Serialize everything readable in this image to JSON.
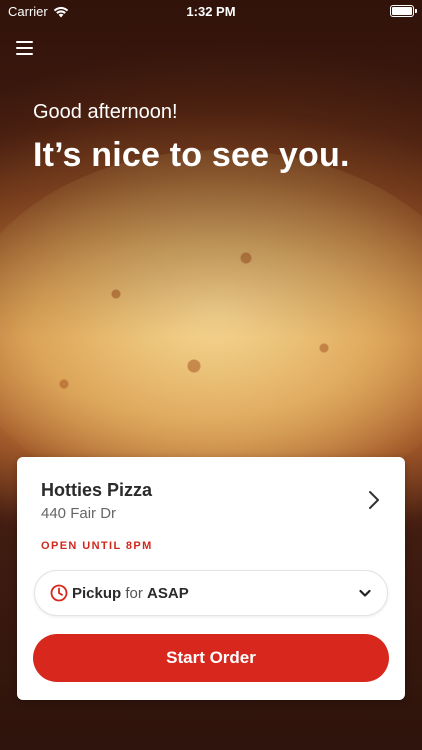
{
  "status_bar": {
    "carrier": "Carrier",
    "time": "1:32 PM"
  },
  "hero": {
    "greeting": "Good afternoon!",
    "headline": "It’s nice to see you."
  },
  "store": {
    "name": "Hotties Pizza",
    "address": "440 Fair Dr",
    "hours_status": "OPEN UNTIL 8PM"
  },
  "order": {
    "type": "Pickup",
    "connector": "for",
    "time": "ASAP"
  },
  "actions": {
    "start_order": "Start Order"
  },
  "colors": {
    "accent": "#d8281d",
    "status_text": "#d0281c"
  },
  "icons": {
    "menu": "hamburger-menu-icon",
    "wifi": "wifi-icon",
    "battery": "battery-icon",
    "chevron_right": "chevron-right-icon",
    "clock": "clock-icon",
    "chevron_down": "chevron-down-icon"
  }
}
